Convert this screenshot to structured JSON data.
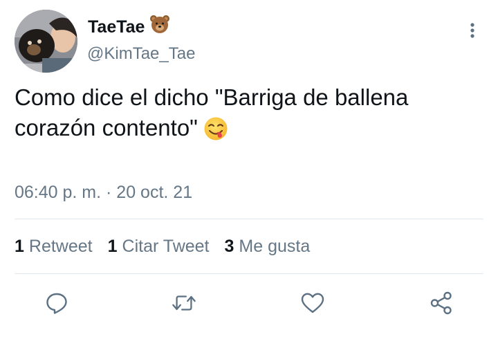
{
  "user": {
    "display_name": "TaeTae",
    "name_emoji": "bear-face-emoji",
    "handle": "@KimTae_Tae",
    "avatar": "profile-photo"
  },
  "tweet": {
    "text": "Como dice el dicho \"Barriga de ballena corazón contento\"",
    "emoji": "face-savoring-food-emoji",
    "timestamp": "06:40 p. m. · 20 oct. 21"
  },
  "stats": {
    "retweets_count": "1",
    "retweets_label": "Retweet",
    "quotes_count": "1",
    "quotes_label": "Citar Tweet",
    "likes_count": "3",
    "likes_label": "Me gusta"
  },
  "actions": [
    "reply-icon",
    "retweet-icon",
    "like-icon",
    "share-icon"
  ],
  "colors": {
    "text": "#0f1419",
    "secondary": "#657786",
    "divider": "#e1e8ed",
    "icon": "#5b7083"
  }
}
